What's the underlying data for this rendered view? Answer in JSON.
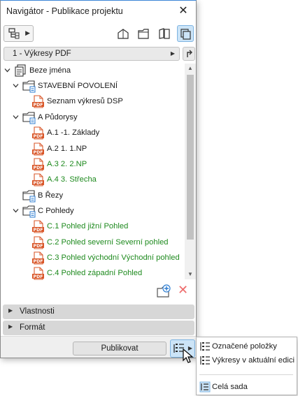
{
  "window": {
    "title": "Navigátor - Publikace projektu",
    "close_glyph": "✕"
  },
  "toolbar": {
    "left_icon": "tree-view-icon",
    "buttons": [
      {
        "icon": "project-map-icon"
      },
      {
        "icon": "view-map-icon"
      },
      {
        "icon": "layout-book-icon"
      },
      {
        "icon": "publisher-sets-icon",
        "active": true
      }
    ]
  },
  "map_selector": {
    "selected": "1 - Výkresy PDF"
  },
  "tree": {
    "items": [
      {
        "label": "Beze jména",
        "type": "root",
        "expander": "down",
        "color": "default"
      },
      {
        "label": "STAVEBNÍ POVOLENÍ",
        "type": "folder",
        "expander": "down",
        "color": "default"
      },
      {
        "label": "Seznam výkresů DSP",
        "type": "pdf",
        "expander": "none",
        "color": "default"
      },
      {
        "label": "A Půdorysy",
        "type": "folder",
        "expander": "down",
        "color": "default"
      },
      {
        "label": "A.1 -1. Základy",
        "type": "pdf",
        "expander": "none",
        "color": "default"
      },
      {
        "label": "A.2 1. 1.NP",
        "type": "pdf",
        "expander": "none",
        "color": "default"
      },
      {
        "label": "A.3 2. 2.NP",
        "type": "pdf",
        "expander": "none",
        "color": "green"
      },
      {
        "label": "A.4 3. Střecha",
        "type": "pdf",
        "expander": "none",
        "color": "green"
      },
      {
        "label": "B Řezy",
        "type": "folder",
        "expander": "none",
        "color": "default"
      },
      {
        "label": "C Pohledy",
        "type": "folder",
        "expander": "down",
        "color": "default"
      },
      {
        "label": "C.1 Pohled jižní Pohled",
        "type": "pdf",
        "expander": "none",
        "color": "green"
      },
      {
        "label": "C.2 Pohled severní Severní pohled",
        "type": "pdf",
        "expander": "none",
        "color": "green"
      },
      {
        "label": "C.3 Pohled východní Východní pohled",
        "type": "pdf",
        "expander": "none",
        "color": "green"
      },
      {
        "label": "C.4 Pohled západní Pohled",
        "type": "pdf",
        "expander": "none",
        "color": "green"
      }
    ]
  },
  "sections": [
    {
      "label": "Vlastnosti"
    },
    {
      "label": "Formát"
    }
  ],
  "footer": {
    "publish_label": "Publikovat"
  },
  "publish_menu": {
    "items": [
      {
        "label": "Označené položky"
      },
      {
        "label": "Výkresy v aktuální edici"
      },
      {
        "label": "Celá sada"
      }
    ]
  },
  "colors": {
    "green_text": "#1e8a1e",
    "active_button": "#cce4f7",
    "delete_icon": "#ee6b6b",
    "pdf_icon": "#d9582b"
  }
}
